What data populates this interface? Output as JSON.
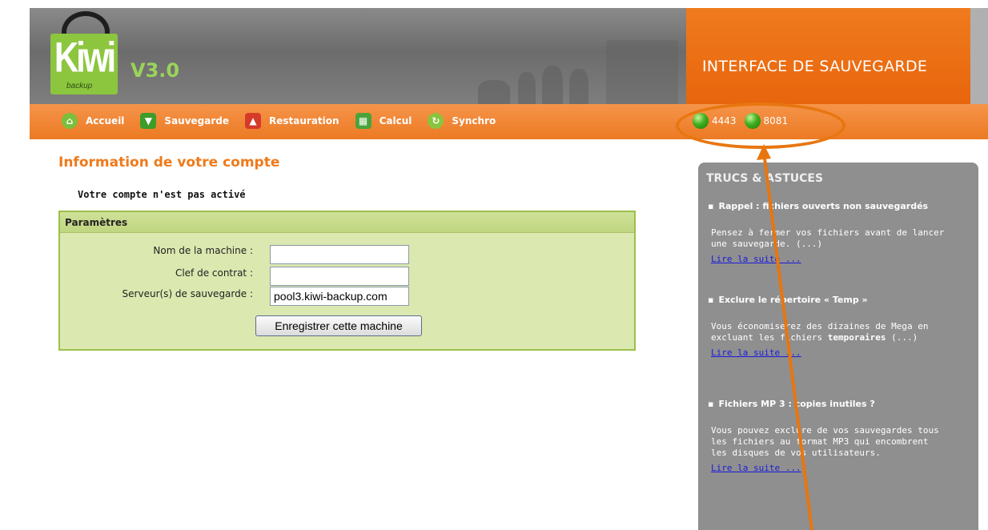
{
  "header": {
    "logo_text": "Kiwi",
    "logo_subtext": "backup",
    "version": "V3.0",
    "title": "INTERFACE DE SAUVEGARDE"
  },
  "nav": {
    "items": [
      {
        "label": "Accueil",
        "icon": "home-icon"
      },
      {
        "label": "Sauvegarde",
        "icon": "backup-icon"
      },
      {
        "label": "Restauration",
        "icon": "restore-icon"
      },
      {
        "label": "Calcul",
        "icon": "calculator-icon"
      },
      {
        "label": "Synchro",
        "icon": "sync-icon"
      }
    ],
    "status": [
      {
        "label": "4443",
        "color": "#3fae1f"
      },
      {
        "label": "8081",
        "color": "#3fae1f"
      }
    ]
  },
  "main": {
    "title": "Information de votre compte",
    "account_status": "Votre compte n'est pas activé",
    "form": {
      "legend": "Paramètres",
      "machine_label": "Nom de la machine :",
      "machine_value": "",
      "contract_label": "Clef de contrat :",
      "contract_value": "",
      "server_label": "Serveur(s) de sauvegarde :",
      "server_value": "pool3.kiwi-backup.com",
      "submit_label": "Enregistrer cette machine"
    }
  },
  "tips": {
    "title": "TRUCS & ASTUCES",
    "items": [
      {
        "heading": "Rappel : fichiers ouverts non sauvegardés",
        "body": "Pensez à fermer vos fichiers avant de lancer une sauvegarde. (...)",
        "link": "Lire la suite ..."
      },
      {
        "heading": "Exclure le répertoire « Temp »",
        "body_pre": "Vous économiserez des dizaines de Mega en excluant les fichiers ",
        "body_bold": "temporaires",
        "body_post": " (...)",
        "link": "Lire la suite ..."
      },
      {
        "heading": "Fichiers MP 3 : copies inutiles ?",
        "body": "Vous pouvez exclure de vos sauvegardes tous les fichiers au format MP3 qui encombrent les disques de vos utilisateurs.",
        "link": "Lire la suite ..."
      }
    ]
  },
  "colors": {
    "accent_orange": "#ec7a23",
    "status_green": "#3fae1f",
    "panel_gray": "#8f8f8f",
    "form_bg": "#dbe8b0"
  }
}
